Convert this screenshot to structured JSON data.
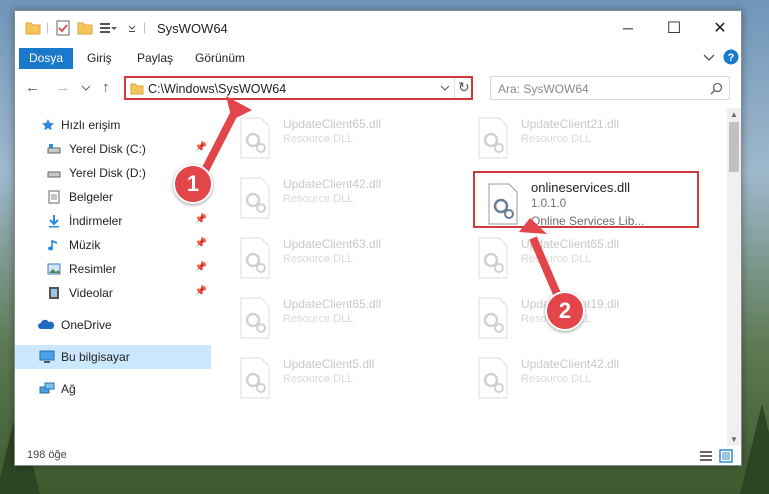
{
  "window": {
    "title": "SysWOW64",
    "controls": {
      "minimize": "─",
      "maximize": "☐",
      "close": "✕"
    }
  },
  "ribbon": {
    "tabs": [
      "Dosya",
      "Giriş",
      "Paylaş",
      "Görünüm"
    ],
    "active_tab": "Dosya"
  },
  "address": {
    "path": "C:\\Windows\\SysWOW64",
    "search_placeholder": "Ara: SysWOW64"
  },
  "nav": {
    "items": [
      {
        "label": "Hızlı erişim",
        "icon": "star-icon"
      },
      {
        "label": "Yerel Disk (C:)",
        "icon": "drive-icon",
        "pinned": true
      },
      {
        "label": "Yerel Disk (D:)",
        "icon": "drive-icon"
      },
      {
        "label": "Belgeler",
        "icon": "documents-icon",
        "pinned": true
      },
      {
        "label": "İndirmeler",
        "icon": "download-icon",
        "pinned": true
      },
      {
        "label": "Müzik",
        "icon": "music-icon",
        "pinned": true
      },
      {
        "label": "Resimler",
        "icon": "pictures-icon",
        "pinned": true
      },
      {
        "label": "Videolar",
        "icon": "videos-icon",
        "pinned": true
      },
      {
        "label": "OneDrive",
        "icon": "cloud-icon"
      },
      {
        "label": "Bu bilgisayar",
        "icon": "computer-icon",
        "selected": true
      },
      {
        "label": "Ağ",
        "icon": "network-icon"
      }
    ]
  },
  "files": [
    {
      "name": "UpdateClient65.dll",
      "type": "Resource DLL"
    },
    {
      "name": "UpdateClient21.dll",
      "type": "Resource DLL"
    },
    {
      "name": "UpdateClient42.dll",
      "type": "Resource DLL"
    },
    {
      "name": "onlineservices.dll",
      "version": "1.0.1.0",
      "type": "Online Services Lib...",
      "highlighted": true
    },
    {
      "name": "UpdateClient63.dll",
      "type": "Resource DLL"
    },
    {
      "name": "UpdateClient65.dll",
      "type": "Resource DLL"
    },
    {
      "name": "UpdateClient65.dll",
      "type": "Resource DLL"
    },
    {
      "name": "UpdateClient19.dll",
      "type": "Resource DLL"
    },
    {
      "name": "UpdateClient5.dll",
      "type": "Resource DLL"
    },
    {
      "name": "UpdateClient42.dll",
      "type": "Resource DLL"
    }
  ],
  "status": {
    "item_count": "198 öğe"
  },
  "annotations": {
    "step1": "1",
    "step2": "2"
  },
  "colors": {
    "accent": "#1979ca",
    "highlight": "#d03a3f",
    "selected_bg": "#cce8ff"
  }
}
